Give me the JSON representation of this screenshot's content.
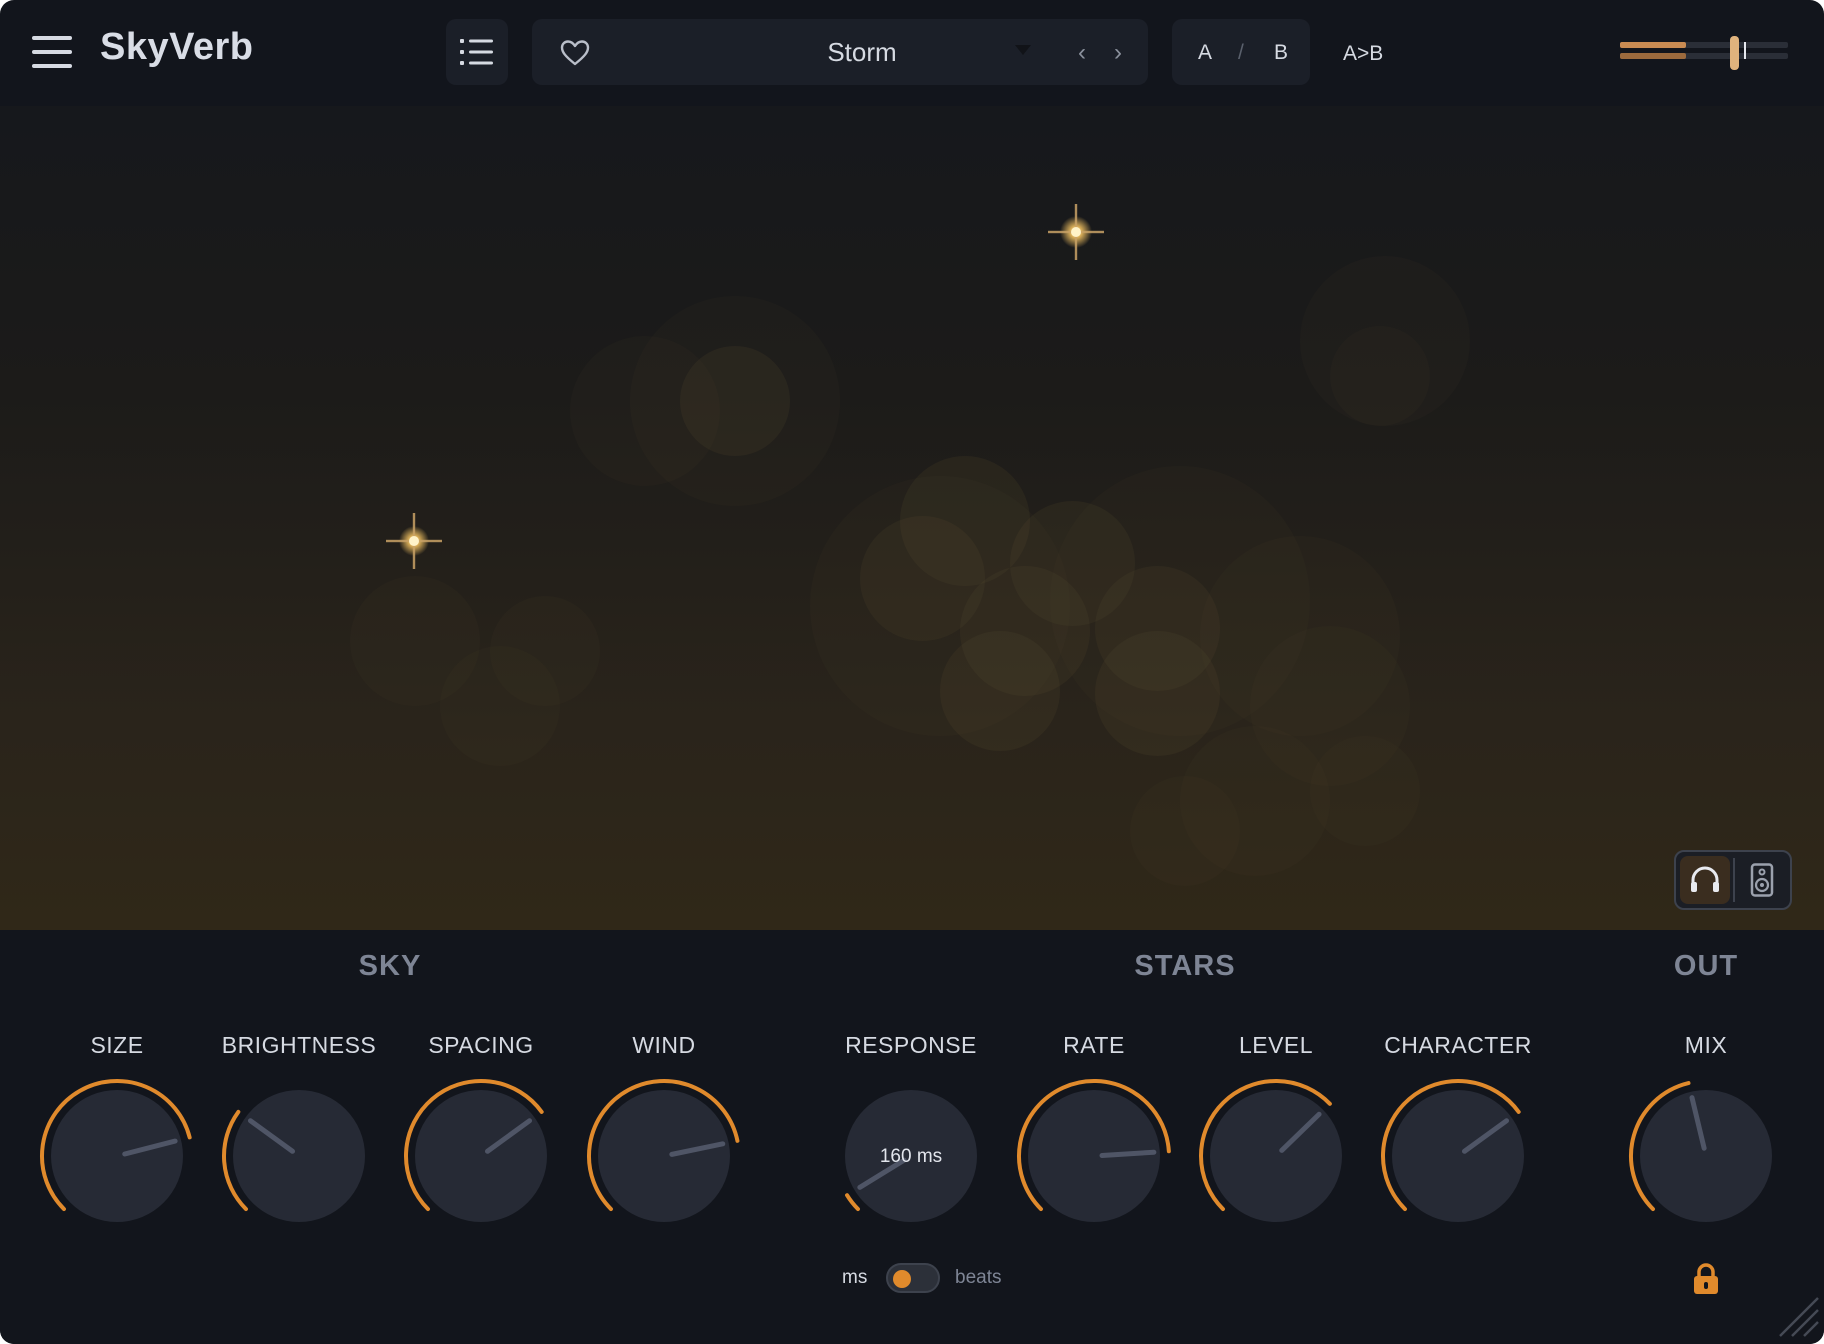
{
  "header": {
    "app_title": "SkyVerb",
    "preset_name": "Storm",
    "prev_symbol": "‹",
    "next_symbol": "›",
    "ab_a": "A",
    "ab_separator": "/",
    "ab_b": "B",
    "ab_copy": "A>B",
    "icons": [
      "hamburger-menu-icon",
      "preset-list-icon",
      "heart-icon",
      "dropdown-caret-icon",
      "output-meter"
    ]
  },
  "visualizer": {
    "monitor_modes": [
      "headphones",
      "speaker"
    ],
    "active_monitor": "headphones"
  },
  "sections": {
    "sky": "SKY",
    "stars": "STARS",
    "out": "OUT"
  },
  "knobs": {
    "size": {
      "label": "SIZE",
      "level": 0.78
    },
    "brightness": {
      "label": "BRIGHTNESS",
      "level": 0.3
    },
    "spacing": {
      "label": "SPACING",
      "level": 0.7
    },
    "wind": {
      "label": "WIND",
      "level": 0.79
    },
    "response": {
      "label": "RESPONSE",
      "value": "160 ms",
      "level": 0.05
    },
    "rate": {
      "label": "RATE",
      "level": 0.82
    },
    "level": {
      "label": "LEVEL",
      "level": 0.67
    },
    "character": {
      "label": "CHARACTER",
      "level": 0.7
    },
    "mix": {
      "label": "MIX",
      "level": 0.45
    }
  },
  "response_units": {
    "left": "ms",
    "right": "beats",
    "selected": "ms"
  },
  "colors": {
    "accent": "#e08a2c",
    "background": "#12151c",
    "knob_body": "#262a35",
    "pointer": "#4f5566"
  }
}
